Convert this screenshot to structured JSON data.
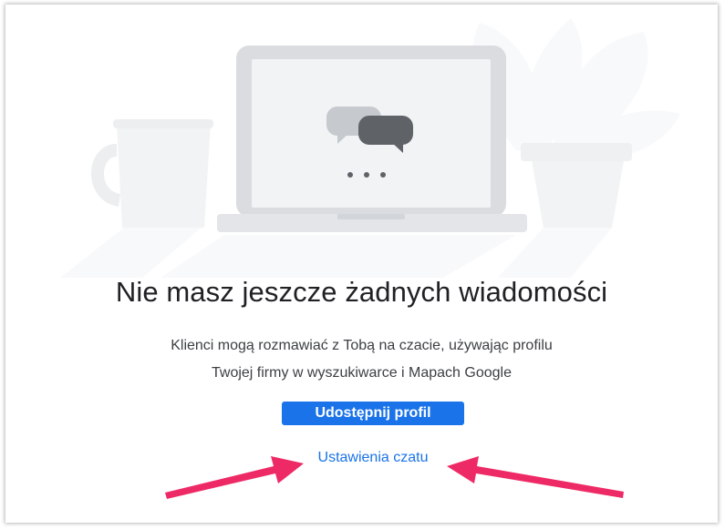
{
  "empty_state": {
    "title": "Nie masz jeszcze żadnych wiadomości",
    "description_line1": "Klienci mogą rozmawiać z Tobą na czacie, używając profilu",
    "description_line2": "Twojej firmy w wyszukiwarce i Mapach Google",
    "share_button_label": "Udostępnij profil",
    "settings_link_label": "Ustawienia czatu"
  },
  "colors": {
    "accent": "#1a73e8",
    "title_text": "#202124",
    "body_text": "#3c4043",
    "annotation_arrow": "#ee2a66"
  },
  "icons": [
    "mug-icon",
    "laptop-icon",
    "chat-bubbles-icon",
    "plant-icon",
    "arrow-annotation-icon"
  ]
}
